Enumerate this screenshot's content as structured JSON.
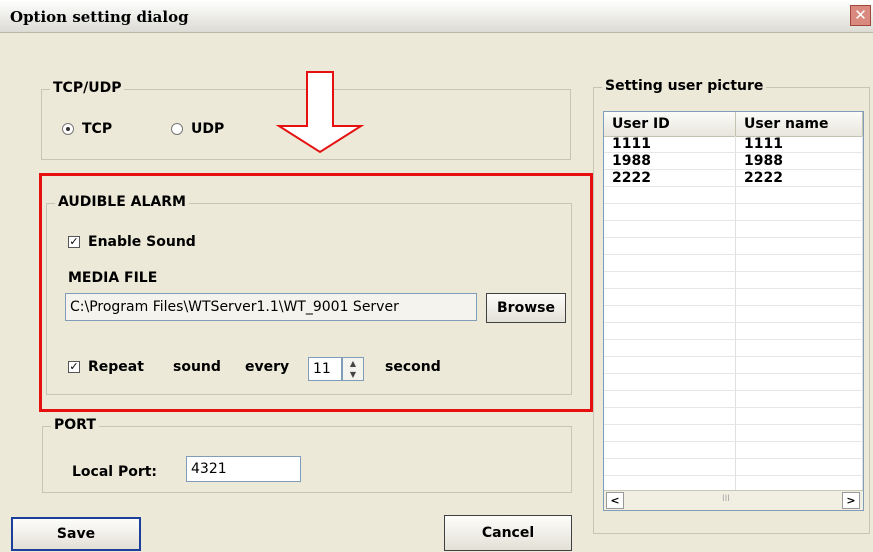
{
  "window": {
    "title": "Option setting dialog",
    "close_glyph": "✕"
  },
  "tcp_udp": {
    "legend": "TCP/UDP",
    "options": [
      {
        "label": "TCP",
        "selected": true
      },
      {
        "label": "UDP",
        "selected": false
      }
    ]
  },
  "audible_alarm": {
    "legend": "AUDIBLE ALARM",
    "enable_sound_label": "Enable Sound",
    "enable_sound_checked": true,
    "media_file_label": "MEDIA FILE",
    "media_file_value": "C:\\Program Files\\WTServer1.1\\WT_9001 Server",
    "browse_label": "Browse",
    "repeat_checked": true,
    "repeat_label": "Repeat",
    "sound_label": "sound",
    "every_label": "every",
    "interval_value": "11",
    "second_label": "second"
  },
  "port": {
    "legend": "PORT",
    "local_port_label": "Local Port:",
    "local_port_value": "4321"
  },
  "user_picture": {
    "legend": "Setting user picture",
    "columns": [
      "User ID",
      "User name"
    ],
    "rows": [
      [
        "1111",
        "1111"
      ],
      [
        "1988",
        "1988"
      ],
      [
        "2222",
        "2222"
      ]
    ],
    "scroll_left": "<",
    "scroll_right": ">",
    "scroll_grip": "III"
  },
  "buttons": {
    "save": "Save",
    "cancel": "Cancel"
  },
  "annotation": {
    "arrow_color": "#e61010",
    "highlight_color": "#e61010"
  }
}
